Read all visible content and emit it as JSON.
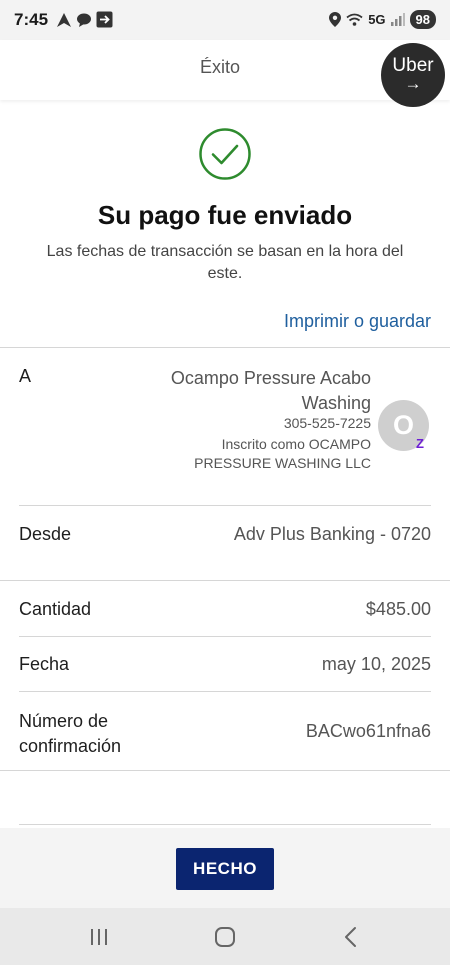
{
  "status_bar": {
    "time": "7:45",
    "network": "5G",
    "battery": "98"
  },
  "header": {
    "title": "Éxito",
    "uber_label": "Uber",
    "uber_arrow": "→"
  },
  "success": {
    "icon": "checkmark-circle-icon",
    "title": "Su pago fue enviado",
    "subtitle": "Las fechas de transacción se basan en la hora del este.",
    "print_link": "Imprimir o guardar"
  },
  "recipient": {
    "label": "A",
    "name": "Ocampo Pressure Acabo Washing",
    "phone": "305-525-7225",
    "registered_as": "Inscrito como OCAMPO PRESSURE WASHING LLC",
    "avatar_initial": "O",
    "zelle_mark": "Z"
  },
  "details": {
    "from_label": "Desde",
    "from_value": "Adv Plus Banking - 0720",
    "amount_label": "Cantidad",
    "amount_value": "$485.00",
    "date_label": "Fecha",
    "date_value": "may 10, 2025",
    "confirmation_label": "Número de confirmación",
    "confirmation_value": "BACwo61nfna6"
  },
  "footer": {
    "done_label": "HECHO"
  },
  "colors": {
    "accent_blue": "#1f5f9e",
    "button_navy": "#0b2570",
    "success_green": "#2e8b2e",
    "zelle_purple": "#6d1ed4"
  }
}
